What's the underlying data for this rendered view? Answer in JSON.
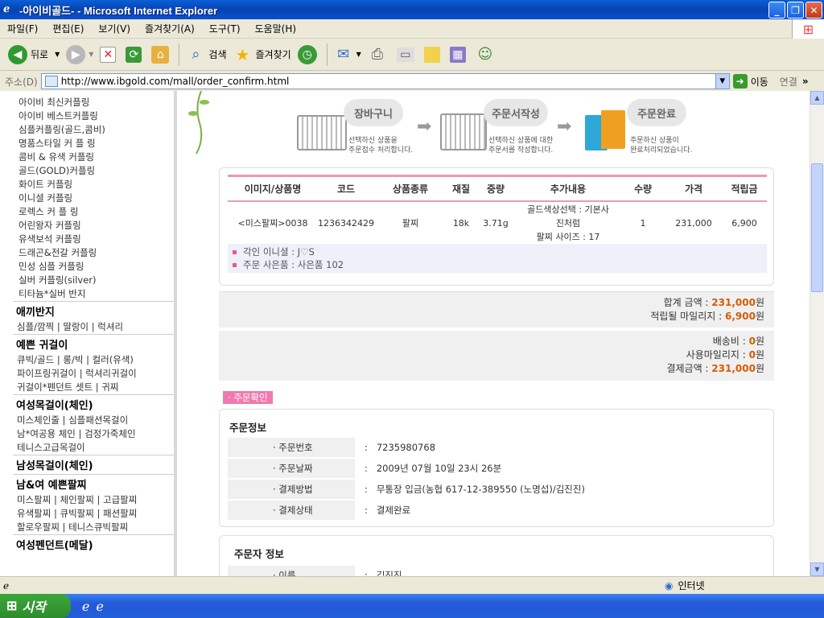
{
  "window": {
    "title": "-아이비골드- - Microsoft Internet Explorer"
  },
  "menu": [
    "파일(F)",
    "편집(E)",
    "보기(V)",
    "즐겨찾기(A)",
    "도구(T)",
    "도움말(H)"
  ],
  "toolbar": {
    "back": "뒤로",
    "search": "검색",
    "favorites": "즐겨찾기"
  },
  "address": {
    "label": "주소(D)",
    "url": "http://www.ibgold.com/mall/order_confirm.html",
    "go": "이동",
    "links": "연결"
  },
  "status": {
    "zone": "인터넷"
  },
  "taskbar": {
    "start": "시작"
  },
  "sidebar": {
    "top_items": [
      "아이비 최신커플링",
      "아이비 베스트커플링",
      "심플커플링(골드,콤비)",
      "명품스타일 커 플 링",
      "콤비 & 유색 커플링",
      "골드(GOLD)커플링",
      "화이트 커플링",
      "이니셜 커플링",
      "로렉스 커 플 링",
      "어린왕자 커플링",
      "유색보석 커플링",
      "드래곤&전갈 커플링",
      "민성 심플 커플링",
      "실버 커플링(silver)",
      "티타늄*실버 반지"
    ],
    "sections": [
      {
        "title": "애끼반지",
        "lines": [
          "심플/깜찍 | 딸랑이 | 럭셔리"
        ]
      },
      {
        "title": "예쁜 귀걸이",
        "lines": [
          "큐빅/골드 | 롱/빅 | 컬러(유색)",
          "파이프링귀걸이 | 럭셔리귀걸이",
          "귀걸이*펜던트 셋트 | 귀찌"
        ]
      },
      {
        "title": "여성목걸이(체인)",
        "lines": [
          "미스체인줄 | 심플패션목걸이",
          "남*여공용 체인 | 검정가죽체인",
          "테니스고급목걸이"
        ]
      },
      {
        "title": "남성목걸이(체인)",
        "lines": []
      },
      {
        "title": "남&여 예쁜팔찌",
        "lines": [
          "미스팔찌 | 체인팔찌 | 고급팔찌",
          "유색팔찌 | 큐빅팔찌 | 패션팔찌",
          "할로우팔찌 | 테니스큐빅팔찌"
        ]
      },
      {
        "title": "여성펜던트(메달)",
        "lines": []
      }
    ]
  },
  "steps": [
    {
      "title": "장바구니",
      "desc1": "선택하신 상품을",
      "desc2": "주문접수 처리합니다."
    },
    {
      "title": "주문서작성",
      "desc1": "선택하신 상품에 대한",
      "desc2": "주문서를 작성합니다."
    },
    {
      "title": "주문완료",
      "desc1": "주문하신 상품이",
      "desc2": "완료처리되었습니다."
    }
  ],
  "order_table": {
    "headers": [
      "이미지/상품명",
      "코드",
      "상품종류",
      "재질",
      "중량",
      "추가내용",
      "수량",
      "가격",
      "적립금"
    ],
    "row": {
      "name": "<미스팔찌>0038",
      "code": "1236342429",
      "type": "팔찌",
      "material": "18k",
      "weight": "3.71g",
      "extra1": "골드색상선택 : 기본사",
      "extra2": "진처럼",
      "extra3": "팔찌 사이즈 : 17",
      "qty": "1",
      "price": "231,000",
      "points": "6,900"
    },
    "options": [
      "각인 이니셜 : J♡S",
      "주문 사은품 : 사은품 102"
    ]
  },
  "summary": {
    "total_label": "합계 금액 : ",
    "total": "231,000",
    "unit": "원",
    "mileage_label": "적립될 마일리지 : ",
    "mileage": "6,900",
    "shipping_label": "배송비 : ",
    "shipping": "0",
    "used_label": "사용마일리지 : ",
    "used": "0",
    "pay_label": "결제금액 : ",
    "pay": "231,000"
  },
  "confirm_tag": "· 주문확인",
  "order_info": {
    "title": "주문정보",
    "rows": [
      {
        "k": "· 주문번호",
        "v": "7235980768"
      },
      {
        "k": "· 주문날짜",
        "v": "2009년 07월 10일 23시 26분"
      },
      {
        "k": "· 결제방법",
        "v": "무통장 입금(농협 617-12-389550 (노명섭)/김진진)"
      },
      {
        "k": "· 결제상태",
        "v": "결제완료"
      }
    ]
  },
  "orderer_info": {
    "title": "주문자 정보",
    "name_label": "· 이름",
    "name": "김진진"
  },
  "colors": {
    "accent_pink": "#e89ab8",
    "emphasis": "#d85a00",
    "xp_blue": "#0842b0"
  }
}
